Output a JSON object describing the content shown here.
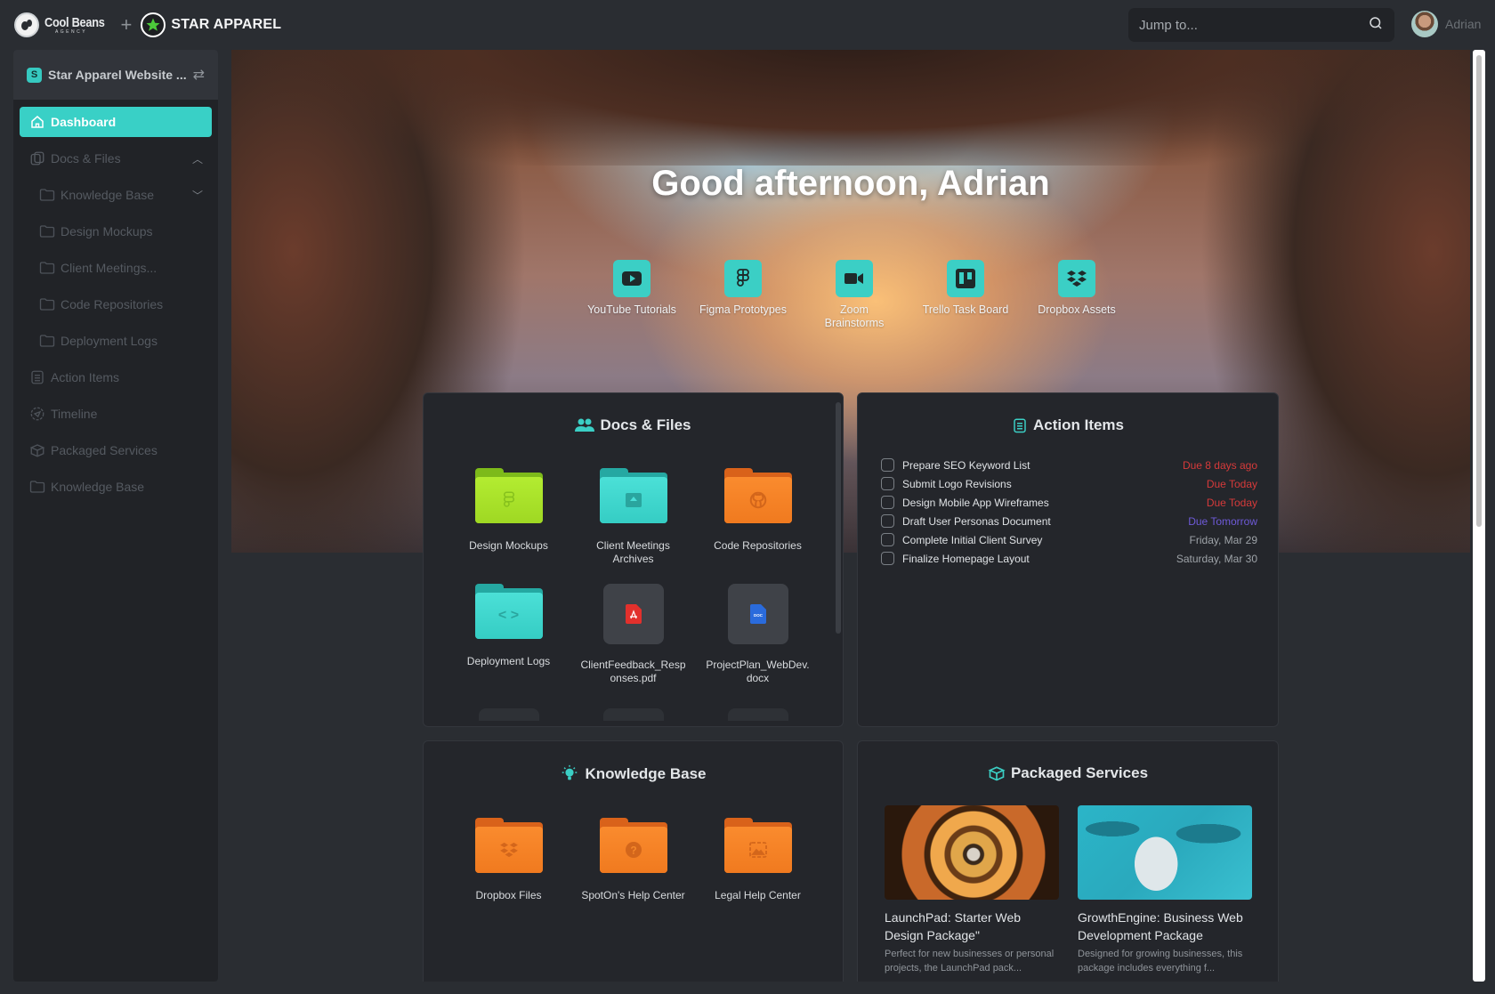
{
  "header": {
    "agency_name": "Cool Beans",
    "agency_sub": "AGENCY",
    "plus": "+",
    "client_name": "STAR APPAREL",
    "search": {
      "placeholder": "Jump to...",
      "value": ""
    },
    "user": {
      "name": "Adrian"
    }
  },
  "sidebar": {
    "workspace": {
      "badge": "S",
      "name": "Star Apparel Website ...",
      "swap_icon": "swap-icon"
    },
    "items": [
      {
        "label": "Dashboard",
        "icon": "home-icon",
        "active": true
      },
      {
        "label": "Docs & Files",
        "icon": "docs-icon",
        "expanded": true
      },
      {
        "label": "Knowledge Base",
        "icon": "folder-icon",
        "sub": true,
        "collapsible": true
      },
      {
        "label": "Design Mockups",
        "icon": "folder-icon",
        "sub": true
      },
      {
        "label": "Client Meetings...",
        "icon": "folder-icon",
        "sub": true
      },
      {
        "label": "Code Repositories",
        "icon": "folder-icon",
        "sub": true
      },
      {
        "label": "Deployment Logs",
        "icon": "folder-icon",
        "sub": true
      },
      {
        "label": "Action Items",
        "icon": "checklist-icon"
      },
      {
        "label": "Timeline",
        "icon": "timeline-icon"
      },
      {
        "label": "Packaged Services",
        "icon": "box-icon"
      },
      {
        "label": "Knowledge Base",
        "icon": "folder-icon"
      }
    ]
  },
  "hero": {
    "greeting": "Good afternoon, Adrian",
    "quick_links": [
      {
        "label": "YouTube Tutorials",
        "icon": "youtube-icon"
      },
      {
        "label": "Figma Prototypes",
        "icon": "figma-icon"
      },
      {
        "label": "Zoom Brainstorms",
        "icon": "zoom-video-icon"
      },
      {
        "label": "Trello Task Board",
        "icon": "trello-icon"
      },
      {
        "label": "Dropbox Assets",
        "icon": "dropbox-icon"
      }
    ]
  },
  "docs": {
    "title": "Docs & Files",
    "items": [
      {
        "label": "Design Mockups",
        "type": "folder",
        "color": "#a6e22a",
        "icon": "figma-icon"
      },
      {
        "label": "Client Meetings Archives",
        "type": "folder",
        "color": "#3fd3cb",
        "icon": "archive-icon"
      },
      {
        "label": "Code Repositories",
        "type": "folder",
        "color": "#f27f22",
        "icon": "github-icon"
      },
      {
        "label": "Deployment Logs",
        "type": "folder",
        "color": "#3fd3cb",
        "icon": "code-icon"
      },
      {
        "label": "ClientFeedback_Responses.pdf",
        "type": "file",
        "icon": "pdf-icon"
      },
      {
        "label": "ProjectPlan_WebDev.docx",
        "type": "file",
        "icon": "doc-icon"
      }
    ]
  },
  "action_items": {
    "title": "Action Items",
    "items": [
      {
        "name": "Prepare SEO Keyword List",
        "due": "Due 8 days ago",
        "status": "overdue"
      },
      {
        "name": "Submit Logo Revisions",
        "due": "Due Today",
        "status": "overdue"
      },
      {
        "name": "Design Mobile App Wireframes",
        "due": "Due Today",
        "status": "overdue"
      },
      {
        "name": "Draft User Personas Document",
        "due": "Due Tomorrow",
        "status": "soon"
      },
      {
        "name": "Complete Initial Client Survey",
        "due": "Friday, Mar 29",
        "status": "normal"
      },
      {
        "name": "Finalize Homepage Layout",
        "due": "Saturday, Mar 30",
        "status": "normal"
      }
    ],
    "status_colors": {
      "overdue": "#d63a3a",
      "soon": "#6e5ad8",
      "normal": "#9ea3a8"
    }
  },
  "knowledge_base": {
    "title": "Knowledge Base",
    "items": [
      {
        "label": "Dropbox Files",
        "icon": "dropbox-icon"
      },
      {
        "label": "SpotOn's Help Center",
        "icon": "help-icon"
      },
      {
        "label": "Legal Help Center",
        "icon": "image-icon"
      }
    ]
  },
  "packaged_services": {
    "title": "Packaged Services",
    "items": [
      {
        "title": "LaunchPad: Starter Web Design Package\"",
        "desc": "Perfect for new businesses or personal projects, the LaunchPad pack..."
      },
      {
        "title": "GrowthEngine: Business Web Development Package",
        "desc": "Designed for growing businesses, this package includes everything f..."
      }
    ]
  },
  "colors": {
    "accent": "#39d0c6",
    "orange": "#f27f22",
    "lime": "#a6e22a"
  }
}
